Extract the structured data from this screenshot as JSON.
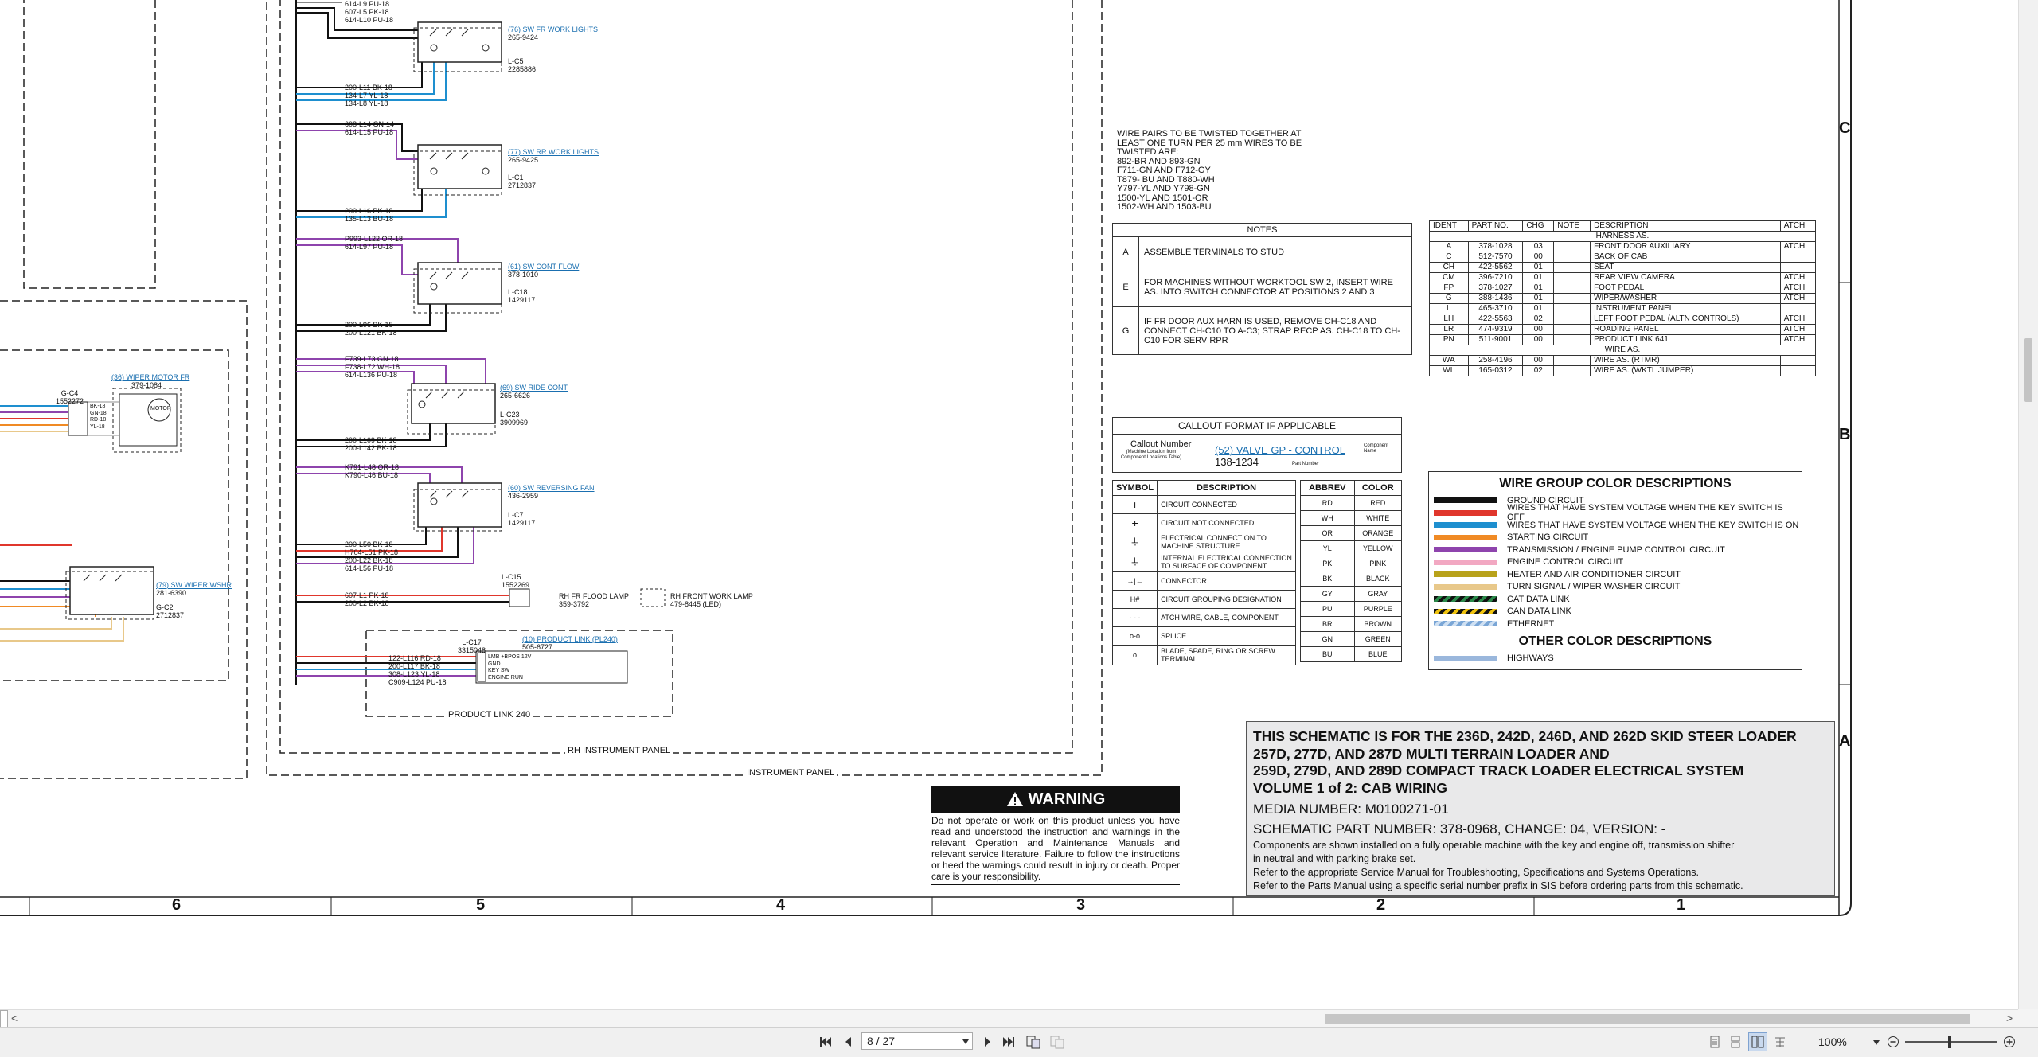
{
  "components": {
    "fr_work_lights": {
      "callout": "(76) SW FR WORK LIGHTS",
      "part": "265-9424",
      "loc": "L-C5",
      "locpart": "2285886"
    },
    "rr_work_lights": {
      "callout": "(77) SW RR WORK LIGHTS",
      "part": "265-9425",
      "loc": "L-C1",
      "locpart": "2712837"
    },
    "cont_flow": {
      "callout": "(61) SW CONT FLOW",
      "part": "378-1010",
      "loc": "L-C18",
      "locpart": "1429117"
    },
    "ride_cont": {
      "callout": "(69) SW RIDE CONT",
      "part": "265-6626",
      "loc": "L-C23",
      "locpart": "3909969"
    },
    "reversing_fan": {
      "callout": "(60) SW REVERSING FAN",
      "part": "436-2959",
      "loc": "L-C7",
      "locpart": "1429117"
    },
    "wiper_motor": {
      "callout": "(36) WIPER MOTOR FR",
      "part": "379-1084",
      "loc": "G-C4",
      "locpart": "1552272"
    },
    "wiper_washer": {
      "callout": "(79) SW WIPER WSHR",
      "part": "281-6390",
      "loc": "G-C2",
      "locpart": "2712837"
    },
    "product_link": {
      "callout": "(10) PRODUCT LINK (PL240)",
      "part": "505-6727",
      "loc": "L-C17",
      "locpart": "3315048"
    },
    "flood_lamp": {
      "label": "RH FR FLOOD LAMP",
      "part": "359-3792",
      "loc": "L-C15",
      "locpart": "1552269"
    },
    "front_work_lamp": {
      "label": "RH FRONT WORK LAMP",
      "part": "479-8445  (LED)"
    }
  },
  "wire_labels": {
    "top": [
      "614-L9 PU-18",
      "607-L5 PK-18",
      "614-L10 PU-18"
    ],
    "fr_lights": [
      "200-L11 BK-18",
      "134-L7 YL-18",
      "134-L8 YL-18"
    ],
    "rr_in": [
      "608-L14 GN-14",
      "614-L15 PU-18"
    ],
    "rr_out": [
      "200-L16 BK-18",
      "135-L13 BU-18"
    ],
    "cont_in": [
      "P993-L122 OR-18",
      "614-L97 PU-18"
    ],
    "cont_out": [
      "200-L96 BK-18",
      "200-L121 BK-18"
    ],
    "ride_in": [
      "F739-L73 GN-18",
      "F738-L72 WH-18",
      "614-L136 PU-18"
    ],
    "ride_out": [
      "200-L109 BK-18",
      "200-L142 BK-18"
    ],
    "fan_in": [
      "K791-L48 OR-18",
      "K790-L46 BU-18"
    ],
    "fan_out": [
      "200-L50 BK-18",
      "H704-L51 PK-18",
      "200-L22 BK-18",
      "614-L56 PU-18"
    ],
    "flood": [
      "607-L1 PK-18",
      "200-L2 BK-18"
    ],
    "plink": [
      "122-L116 RD-18",
      "200-L117 BK-18",
      "308-L123 YL-18",
      "C909-L124 PU-18"
    ],
    "plink_pins": [
      "LMB +BPOS 12V",
      "GND",
      "KEY SW",
      "ENGINE RUN"
    ],
    "wiper_pins": [
      "BK-18",
      "GN-18",
      "RD-18",
      "YL-18"
    ]
  },
  "labels": {
    "product_link_240": "PRODUCT LINK 240",
    "rh_instrument_panel": "RH INSTRUMENT PANEL",
    "instrument_panel": "INSTRUMENT PANEL",
    "motor": "MOTOR"
  },
  "twist_note": [
    "WIRE PAIRS TO BE TWISTED TOGETHER AT",
    "LEAST ONE TURN PER 25 mm WIRES TO BE",
    "TWISTED ARE:",
    "892-BR AND 893-GN",
    "F711-GN AND F712-GY",
    "T879- BU AND T880-WH",
    "Y797-YL AND Y798-GN",
    "1500-YL AND 1501-OR",
    "1502-WH  AND 1503-BU"
  ],
  "notes": {
    "title": "NOTES",
    "rows": [
      {
        "id": "A",
        "text": "ASSEMBLE TERMINALS TO STUD"
      },
      {
        "id": "E",
        "text": "FOR MACHINES WITHOUT WORKTOOL SW 2, INSERT WIRE AS. INTO SWITCH CONNECTOR AT POSITIONS 2 AND 3"
      },
      {
        "id": "G",
        "text": "IF FR DOOR AUX HARN IS USED, REMOVE CH-C18 AND CONNECT CH-C10 TO A-C3; STRAP RECP AS. CH-C18 TO CH-C10 FOR SERV RPR"
      }
    ]
  },
  "parts": {
    "headers": [
      "IDENT",
      "PART NO.",
      "CHG",
      "NOTE",
      "DESCRIPTION",
      "ATCH"
    ],
    "group1": "HARNESS AS.",
    "rows1": [
      [
        "A",
        "378-1028",
        "03",
        "",
        "FRONT DOOR AUXILIARY",
        "ATCH"
      ],
      [
        "C",
        "512-7570",
        "00",
        "",
        "BACK OF CAB",
        ""
      ],
      [
        "CH",
        "422-5562",
        "01",
        "",
        "SEAT",
        ""
      ],
      [
        "CM",
        "396-7210",
        "01",
        "",
        "REAR VIEW CAMERA",
        "ATCH"
      ],
      [
        "FP",
        "378-1027",
        "01",
        "",
        "FOOT PEDAL",
        "ATCH"
      ],
      [
        "G",
        "388-1436",
        "01",
        "",
        "WIPER/WASHER",
        "ATCH"
      ],
      [
        "L",
        "465-3710",
        "01",
        "",
        "INSTRUMENT PANEL",
        ""
      ],
      [
        "LH",
        "422-5563",
        "02",
        "",
        "LEFT FOOT PEDAL (ALTN CONTROLS)",
        "ATCH"
      ],
      [
        "LR",
        "474-9319",
        "00",
        "",
        "ROADING PANEL",
        "ATCH"
      ],
      [
        "PN",
        "511-9001",
        "00",
        "",
        "PRODUCT LINK 641",
        "ATCH"
      ]
    ],
    "group2": "WIRE AS.",
    "rows2": [
      [
        "WA",
        "258-4196",
        "00",
        "",
        "WIRE AS. (RTMR)",
        ""
      ],
      [
        "WL",
        "165-0312",
        "02",
        "",
        "WIRE AS. (WKTL JUMPER)",
        ""
      ]
    ]
  },
  "callout": {
    "title": "CALLOUT FORMAT IF APPLICABLE",
    "callout_number": "Callout Number",
    "machine_loc": "(Machine Location from Component Locations Table)",
    "example": "(52) VALVE GP - CONTROL",
    "component_name": "Component Name",
    "part": "138-1234",
    "part_number": "Part Number"
  },
  "symbols": {
    "headers": [
      "SYMBOL",
      "DESCRIPTION"
    ],
    "rows": [
      {
        "sym": "+",
        "desc": "CIRCUIT CONNECTED"
      },
      {
        "sym": "+",
        "desc": "CIRCUIT NOT CONNECTED"
      },
      {
        "sym": "⏚",
        "desc": "ELECTRICAL CONNECTION TO MACHINE STRUCTURE"
      },
      {
        "sym": "⏚",
        "desc": "INTERNAL ELECTRICAL CONNECTION TO SURFACE OF COMPONENT"
      },
      {
        "sym": "→|←",
        "desc": "CONNECTOR"
      },
      {
        "sym": "H#",
        "desc": "CIRCUIT GROUPING DESIGNATION"
      },
      {
        "sym": "- - -",
        "desc": "ATCH WIRE, CABLE, COMPONENT"
      },
      {
        "sym": "o-o",
        "desc": "SPLICE"
      },
      {
        "sym": "o",
        "desc": "BLADE, SPADE, RING OR SCREW TERMINAL"
      }
    ]
  },
  "colors": {
    "headers": [
      "ABBREV",
      "COLOR"
    ],
    "rows": [
      [
        "RD",
        "RED"
      ],
      [
        "WH",
        "WHITE"
      ],
      [
        "OR",
        "ORANGE"
      ],
      [
        "YL",
        "YELLOW"
      ],
      [
        "PK",
        "PINK"
      ],
      [
        "BK",
        "BLACK"
      ],
      [
        "GY",
        "GRAY"
      ],
      [
        "PU",
        "PURPLE"
      ],
      [
        "BR",
        "BROWN"
      ],
      [
        "GN",
        "GREEN"
      ],
      [
        "BU",
        "BLUE"
      ]
    ]
  },
  "wire_groups": {
    "title": "WIRE GROUP COLOR DESCRIPTIONS",
    "rows": [
      {
        "color": "#111111",
        "label": "GROUND CIRCUIT"
      },
      {
        "color": "#e0362c",
        "label": "WIRES THAT HAVE SYSTEM VOLTAGE WHEN THE KEY SWITCH IS OFF"
      },
      {
        "color": "#1e8fcf",
        "label": "WIRES THAT HAVE SYSTEM VOLTAGE WHEN THE KEY SWITCH IS ON"
      },
      {
        "color": "#f08a24",
        "label": "STARTING CIRCUIT"
      },
      {
        "color": "#8e44ad",
        "label": "TRANSMISSION / ENGINE PUMP CONTROL CIRCUIT"
      },
      {
        "color": "#f2a8c2",
        "label": "ENGINE CONTROL CIRCUIT"
      },
      {
        "color": "#b8a21a",
        "label": "HEATER AND AIR CONDITIONER CIRCUIT"
      },
      {
        "color": "#e8c88a",
        "label": "TURN SIGNAL / WIPER WASHER CIRCUIT"
      },
      {
        "color": "#2a8a4a",
        "label": "CAT DATA LINK"
      },
      {
        "color": "#f1c40f",
        "label": "CAN DATA LINK"
      },
      {
        "color": "#a8c8e8",
        "label": "ETHERNET"
      }
    ],
    "other_title": "OTHER COLOR DESCRIPTIONS",
    "other_rows": [
      {
        "color": "#9ab7dc",
        "label": "HIGHWAYS"
      }
    ]
  },
  "warning": {
    "title": "WARNING",
    "text": "Do not operate or work on this product unless you have read and understood the instruction and warnings in the relevant Operation and Maintenance Manuals and relevant service literature. Failure to follow the instructions or heed the warnings could result in injury or death. Proper care is your responsibility."
  },
  "title_block": {
    "line1": "THIS SCHEMATIC IS FOR THE 236D, 242D, 246D, AND 262D SKID STEER LOADER",
    "line2": "257D, 277D, AND 287D MULTI TERRAIN LOADER AND",
    "line3": "259D, 279D, AND 289D COMPACT TRACK LOADER ELECTRICAL SYSTEM",
    "line4": "VOLUME 1 of 2: CAB WIRING",
    "media": "MEDIA NUMBER: M0100271-01",
    "part": "SCHEMATIC PART NUMBER: 378-0968, CHANGE: 04, VERSION: -",
    "note1": "Components are shown installed on a fully operable machine with the key and engine off, transmission shifter",
    "note2": "in neutral and with parking brake set.",
    "note3": "Refer to the appropriate Service Manual for Troubleshooting, Specifications and Systems Operations.",
    "note4": "Refer to the Parts Manual using a specific serial number prefix in SIS before ordering parts from this schematic."
  },
  "grid": {
    "columns": [
      "6",
      "5",
      "4",
      "3",
      "2",
      "1"
    ],
    "rows": [
      "C",
      "B",
      "A"
    ]
  },
  "viewer": {
    "page": "8 / 27",
    "zoom": "100%",
    "left_arrow": "<",
    "right_arrow": ">"
  }
}
